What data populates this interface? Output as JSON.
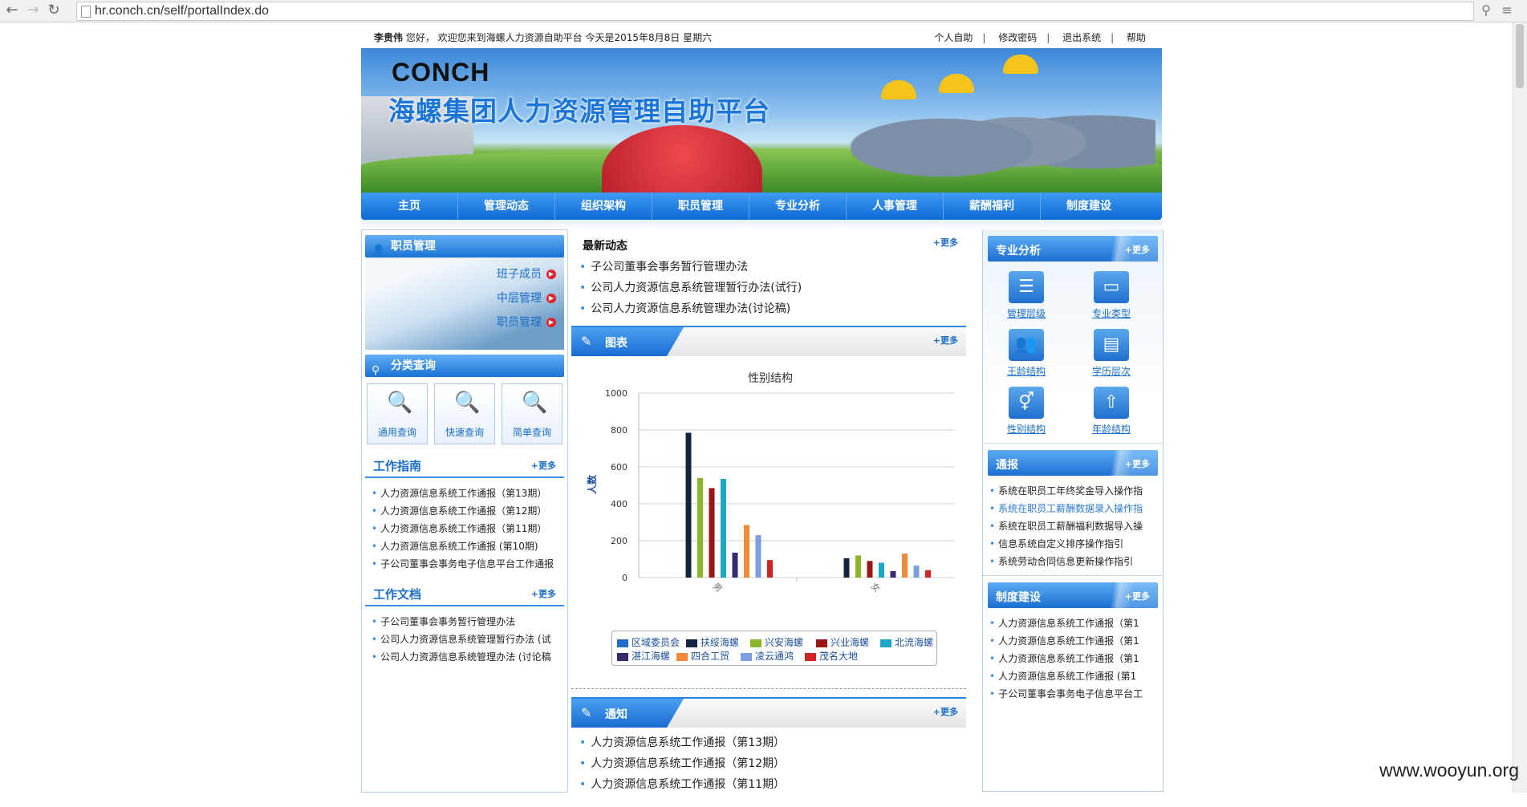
{
  "browser": {
    "url": "hr.conch.cn/self/portalIndex.do"
  },
  "topbar": {
    "user": "李贵伟",
    "greeting": "您好，  欢迎您来到海螺人力资源自助平台  今天是2015年8月8日  星期六",
    "links": [
      "个人自助",
      "修改密码",
      "退出系统",
      "帮助"
    ]
  },
  "banner": {
    "logo": "CONCH",
    "title": "海螺集团人力资源管理自助平台"
  },
  "nav": [
    "主页",
    "管理动态",
    "组织架构",
    "职员管理",
    "专业分析",
    "人事管理",
    "薪酬福利",
    "制度建设"
  ],
  "left": {
    "staff_title": "职员管理",
    "staff_links": [
      "班子成员",
      "中层管理",
      "职员管理"
    ],
    "query_title": "分类查询",
    "query_buttons": [
      "通用查询",
      "快速查询",
      "简单查询"
    ],
    "guide_title": "工作指南",
    "guide_more": "+更多",
    "guide_items": [
      "人力资源信息系统工作通报（第13期）",
      "人力资源信息系统工作通报（第12期）",
      "人力资源信息系统工作通报（第11期）",
      "人力资源信息系统工作通报 (第10期)",
      "子公司董事会事务电子信息平台工作通报"
    ],
    "docs_title": "工作文档",
    "docs_more": "+更多",
    "docs_items": [
      "子公司董事会事务暂行管理办法",
      "公司人力资源信息系统管理暂行办法 (试",
      "公司人力资源信息系统管理办法 (讨论稿"
    ]
  },
  "middle": {
    "news_title": "最新动态",
    "news_more": "+更多",
    "news_items": [
      "子公司董事会事务暂行管理办法",
      "公司人力资源信息系统管理暂行办法(试行)",
      "公司人力资源信息系统管理办法(讨论稿)"
    ],
    "chart_tab": "图表",
    "chart_more": "+更多",
    "notice_tab": "通知",
    "notice_more": "+更多",
    "notice_items": [
      "人力资源信息系统工作通报（第13期）",
      "人力资源信息系统工作通报（第12期）",
      "人力资源信息系统工作通报（第11期）"
    ]
  },
  "right": {
    "analysis_title": "专业分析",
    "analysis_more": "+更多",
    "analysis_items": [
      "管理层级",
      "专业类型",
      "王龄结构",
      "学历层次",
      "性别结构",
      "年龄结构"
    ],
    "report_title": "通报",
    "report_more": "+更多",
    "report_items": [
      "系统在职员工年终奖金导入操作指",
      "系统在职员工薪酬数据录入操作指",
      "系统在职员工薪酬福利数据导入操",
      "信息系统自定义排序操作指引",
      "系统劳动合同信息更新操作指引"
    ],
    "system_title": "制度建设",
    "system_more": "+更多",
    "system_items": [
      "人力资源信息系统工作通报（第1",
      "人力资源信息系统工作通报（第1",
      "人力资源信息系统工作通报（第1",
      "人力资源信息系统工作通报 (第1",
      "子公司董事会事务电子信息平台工"
    ]
  },
  "chart_data": {
    "type": "bar",
    "title": "性别结构",
    "ylabel": "人数",
    "xlabel": "",
    "ylim": [
      0,
      1000
    ],
    "yticks": [
      0,
      200,
      400,
      600,
      800,
      1000
    ],
    "categories": [
      "男",
      "女"
    ],
    "series": [
      {
        "name": "区域委员会",
        "color": "#1f6fc9",
        "values": [
          0,
          0
        ]
      },
      {
        "name": "扶绥海螺",
        "color": "#14233f",
        "values": [
          785,
          105
        ]
      },
      {
        "name": "兴安海螺",
        "color": "#8bb52a",
        "values": [
          540,
          120
        ]
      },
      {
        "name": "兴业海螺",
        "color": "#9a1515",
        "values": [
          485,
          90
        ]
      },
      {
        "name": "北流海螺",
        "color": "#1aa8c8",
        "values": [
          535,
          80
        ]
      },
      {
        "name": "湛江海螺",
        "color": "#3b2a6e",
        "values": [
          135,
          35
        ]
      },
      {
        "name": "四合工贸",
        "color": "#f08a3a",
        "values": [
          285,
          130
        ]
      },
      {
        "name": "凌云通鸿",
        "color": "#7d9fe0",
        "values": [
          230,
          65
        ]
      },
      {
        "name": "茂名大地",
        "color": "#d02525",
        "values": [
          95,
          40
        ]
      }
    ],
    "legend_position": "bottom",
    "grid": true
  },
  "watermark": "www.wooyun.org"
}
